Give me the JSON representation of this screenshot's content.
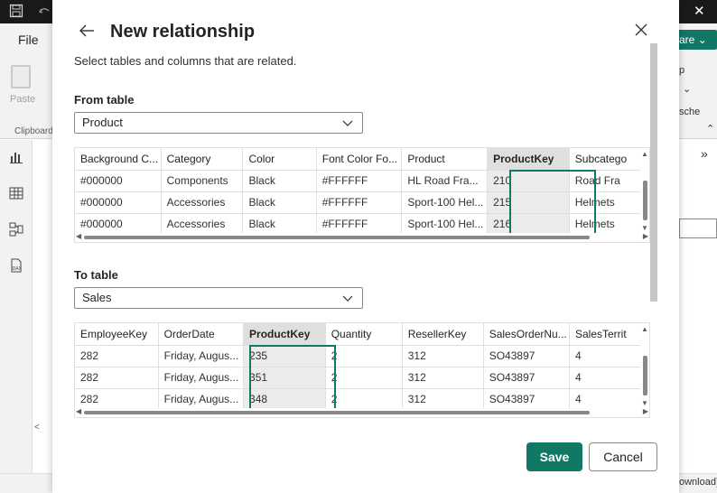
{
  "app": {
    "file_tab": "File",
    "paste_label": "Paste",
    "clipboard_label": "Clipboard",
    "share_label": "are",
    "right_text_1": "p",
    "right_text_2": "sche",
    "status_text": "ownload)",
    "accent_color": "#117865"
  },
  "dialog": {
    "title": "New relationship",
    "subtitle": "Select tables and columns that are related.",
    "from_label": "From table",
    "from_value": "Product",
    "to_label": "To table",
    "to_value": "Sales",
    "save_label": "Save",
    "cancel_label": "Cancel"
  },
  "from_grid": {
    "columns": [
      "Background C...",
      "Category",
      "Color",
      "Font Color Fo...",
      "Product",
      "ProductKey",
      "Subcatego"
    ],
    "selected_column": "ProductKey",
    "rows": [
      [
        "#000000",
        "Components",
        "Black",
        "#FFFFFF",
        "HL Road Fra...",
        "210",
        "Road Fra"
      ],
      [
        "#000000",
        "Accessories",
        "Black",
        "#FFFFFF",
        "Sport-100 Hel...",
        "215",
        "Helmets"
      ],
      [
        "#000000",
        "Accessories",
        "Black",
        "#FFFFFF",
        "Sport-100 Hel...",
        "216",
        "Helmets"
      ]
    ]
  },
  "to_grid": {
    "columns": [
      "EmployeeKey",
      "OrderDate",
      "ProductKey",
      "Quantity",
      "ResellerKey",
      "SalesOrderNu...",
      "SalesTerrit"
    ],
    "selected_column": "ProductKey",
    "rows": [
      [
        "282",
        "Friday, Augus...",
        "235",
        "2",
        "312",
        "SO43897",
        "4"
      ],
      [
        "282",
        "Friday, Augus...",
        "351",
        "2",
        "312",
        "SO43897",
        "4"
      ],
      [
        "282",
        "Friday, Augus...",
        "348",
        "2",
        "312",
        "SO43897",
        "4"
      ]
    ]
  }
}
